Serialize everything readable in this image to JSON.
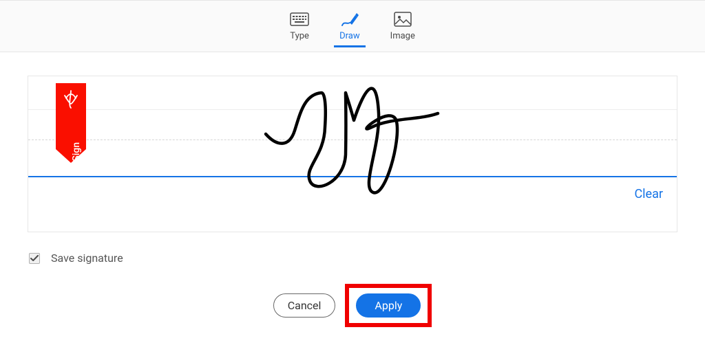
{
  "tabs": {
    "type": "Type",
    "draw": "Draw",
    "image": "Image",
    "active": "draw"
  },
  "bookmark": {
    "label": "Sign"
  },
  "actions": {
    "clear": "Clear",
    "cancel": "Cancel",
    "apply": "Apply"
  },
  "save": {
    "label": "Save signature",
    "checked": true
  },
  "colors": {
    "accent": "#1473e6",
    "bookmark": "#fa0f00",
    "highlight": "#f00000"
  }
}
